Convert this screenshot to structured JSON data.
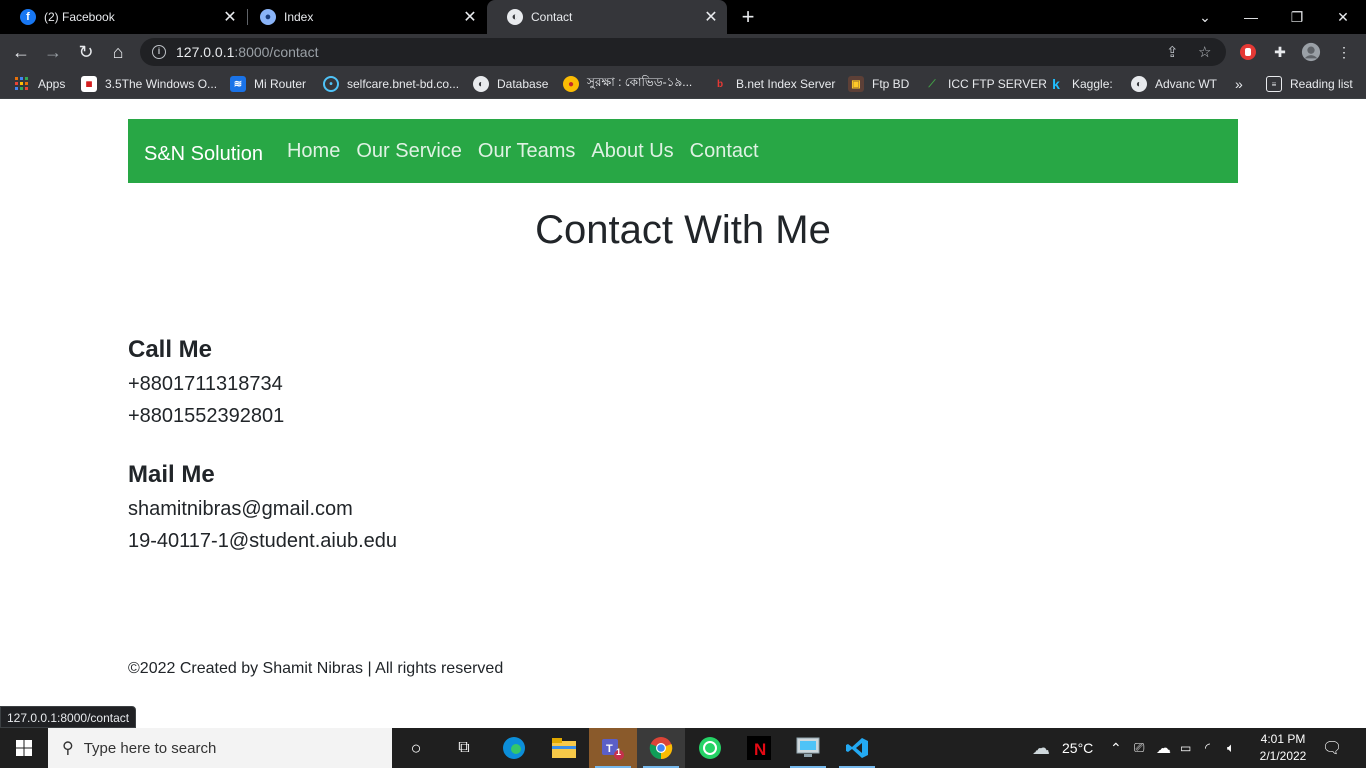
{
  "browser": {
    "tabs": [
      {
        "title": "(2) Facebook",
        "active": false
      },
      {
        "title": "Index",
        "active": false
      },
      {
        "title": "Contact",
        "active": true
      }
    ],
    "url_host": "127.0.0.1",
    "url_path": ":8000/contact",
    "bookmarks": [
      "Apps",
      "3.5The Windows O...",
      "Mi Router",
      "selfcare.bnet-bd.co...",
      "Database",
      "সুরক্ষা : কোভিড-১৯...",
      "B.net Index Server",
      "Ftp BD",
      "ICC FTP SERVER",
      "Kaggle:",
      "Advanc WT"
    ],
    "bookmarks_overflow": "»",
    "reading_list": "Reading list",
    "status_url": "127.0.0.1:8000/contact"
  },
  "site": {
    "brand": "S&N Solution",
    "nav": [
      "Home",
      "Our Service",
      "Our Teams",
      "About Us",
      "Contact"
    ],
    "heading": "Contact With Me",
    "call_title": "Call Me",
    "phones": [
      "+8801711318734",
      "+8801552392801"
    ],
    "mail_title": "Mail Me",
    "emails": [
      "shamitnibras@gmail.com",
      "19-40117-1@student.aiub.edu"
    ],
    "footer": "©2022 Created by Shamit Nibras | All rights reserved",
    "accent_color": "#28a745"
  },
  "taskbar": {
    "search_placeholder": "Type here to search",
    "temperature": "25°C",
    "time": "4:01 PM",
    "date": "2/1/2022",
    "teams_badge": "1"
  }
}
